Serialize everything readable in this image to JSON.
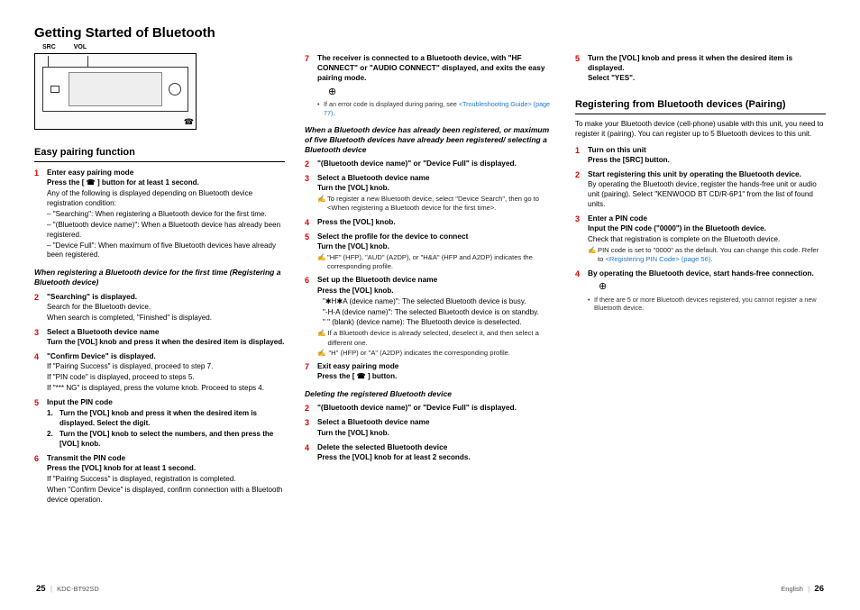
{
  "page_title": "Getting Started of Bluetooth",
  "diagram": {
    "label_src": "SRC",
    "label_vol": "VOL"
  },
  "col1": {
    "heading_easy": "Easy pairing function",
    "s1_t": "Enter easy pairing mode",
    "s1_sub": "Press the [ ☎ ] button for at least 1 second.",
    "s1_b1": "Any of the following is displayed depending on Bluetooth device registration condition:",
    "s1_b2": "\"Searching\": When registering a Bluetooth device for the first time.",
    "s1_b3": "\"(Bluetooth device name)\": When a Bluetooth device has already been registered.",
    "s1_b4": "\"Device Full\": When maximum of five Bluetooth devices have already been registered.",
    "sub_italic1": "When registering a Bluetooth device for the first time (Registering a Bluetooth device)",
    "s2_t": "\"Searching\" is displayed.",
    "s2_b1": "Search for the Bluetooth device.",
    "s2_b2": "When search is completed, \"Finished\" is displayed.",
    "s3_t": "Select a Bluetooth device name",
    "s3_sub": "Turn the [VOL] knob and press it when the desired item is displayed.",
    "s4_t": "\"Confirm Device\" is displayed.",
    "s4_b1": "If \"Pairing Success\" is displayed, proceed to step 7.",
    "s4_b2": "If \"PIN code\" is displayed, proceed to steps 5.",
    "s4_b3": "If \"*** NG\" is displayed, press the volume knob. Proceed to steps 4.",
    "s5_t": "Input the PIN code",
    "s5_sub1_n": "1.",
    "s5_sub1": "Turn the [VOL] knob and press it when the desired item is displayed. Select the digit.",
    "s5_sub2_n": "2.",
    "s5_sub2": "Turn the [VOL] knob to select the numbers, and then press the [VOL] knob.",
    "s6_t": "Transmit the PIN code",
    "s6_sub": "Press the [VOL] knob for at least 1 second.",
    "s6_b1": "If \"Pairing Success\" is displayed, registration is completed.",
    "s6_b2": "When \"Confirm Device\" is displayed, confirm connection with a Bluetooth device operation."
  },
  "col2": {
    "s7_t": "The receiver is connected to a Bluetooth device, with \"HF CONNECT\" or \"AUDIO CONNECT\" displayed, and exits the easy pairing mode.",
    "s7_note": "If an error code is displayed during paring, see",
    "s7_link": "<Troubleshooting Guide> (page 77)",
    "sub_italic2": "When a Bluetooth device has already been registered, or maximum of five Bluetooth devices have already been registered/ selecting a Bluetooth device",
    "s2_t": "\"(Bluetooth device name)\" or \"Device Full\" is displayed.",
    "s3_t": "Select a Bluetooth device name",
    "s3_sub": "Turn the [VOL] knob.",
    "s3_n1": "To register a new Bluetooth device, select \"Device Search\", then go to <When registering a Bluetooth device for the first time>.",
    "s4_t": "Press the [VOL] knob.",
    "s5_t": "Select the profile for the device to connect",
    "s5_sub": "Turn the [VOL] knob.",
    "s5_n1": "\"HF\" (HFP), \"AUD\" (A2DP), or \"H&A\" (HFP and A2DP) indicates the corresponding profile.",
    "s6_t": "Set up the Bluetooth device name",
    "s6_sub": "Press the [VOL] knob.",
    "s6_l1a": "\"✱H✱A (device name)\":",
    "s6_l1b": "The selected Bluetooth device is busy.",
    "s6_l2a": "\"-H-A (device name)\":",
    "s6_l2b": "The selected Bluetooth device is on standby.",
    "s6_l3a": "\" \" (blank) (device name):",
    "s6_l3b": "The Bluetooth device is deselected.",
    "s6_n1": "If a Bluetooth device is already selected, deselect it, and then select a different one.",
    "s6_n2": "\"H\" (HFP) or \"A\" (A2DP) indicates the corresponding profile.",
    "s7b_t": "Exit easy pairing mode",
    "s7b_sub": "Press the [ ☎ ] button.",
    "sub_italic3": "Deleting the registered Bluetooth device",
    "d2_t": "\"(Bluetooth device name)\" or \"Device Full\" is displayed.",
    "d3_t": "Select a Bluetooth device name",
    "d3_sub": "Turn the [VOL] knob.",
    "d4_t": "Delete the selected Bluetooth device",
    "d4_sub": "Press the [VOL] knob for at least 2 seconds."
  },
  "col3": {
    "s5_t": "Turn the [VOL] knob and press it when the desired item is displayed.",
    "s5_sub": "Select \"YES\".",
    "heading_reg": "Registering from Bluetooth devices (Pairing)",
    "intro": "To make your Bluetooth device (cell-phone) usable with this unit, you need to register it (pairing). You can register up to 5 Bluetooth devices to this unit.",
    "r1_t": "Turn on this unit",
    "r1_sub": "Press the [SRC] button.",
    "r2_t": "Start registering this unit by operating the Bluetooth device.",
    "r2_b1": "By operating the Bluetooth device, register the hands-free unit or audio unit (pairing). Select \"KENWOOD BT CD/R-6P1\" from the list of found units.",
    "r3_t": "Enter a PIN code",
    "r3_sub": "Input the PIN code (\"0000\") in the Bluetooth device.",
    "r3_b1": "Check that registration is complete on the Bluetooth device.",
    "r3_n1a": "PIN code is set to \"0000\" as the default. You can change this code. Refer to ",
    "r3_n1b": "<Registering PIN Code> (page 56)",
    "r4_t": "By operating the Bluetooth device, start hands-free connection.",
    "r4_note": "If there are 5 or more Bluetooth devices registered, you cannot register a new Bluetooth device."
  },
  "footer": {
    "left_page": "25",
    "model": "KDC-BT92SD",
    "right_lang": "English",
    "right_page": "26"
  }
}
